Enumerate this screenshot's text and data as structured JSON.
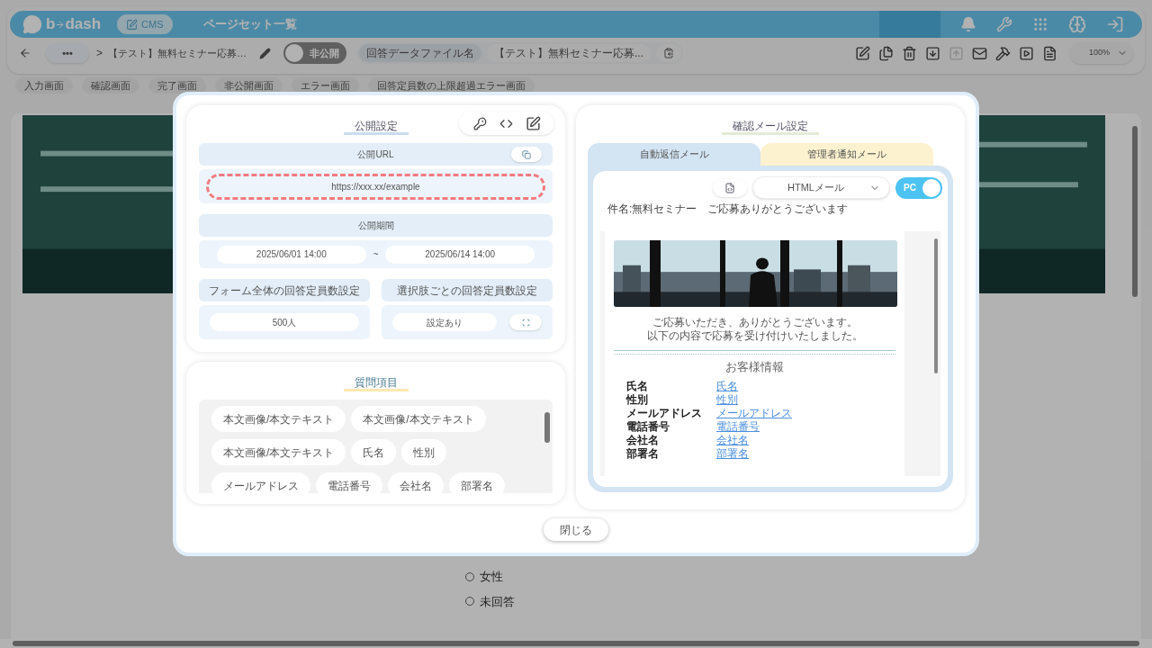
{
  "header": {
    "logo": [
      "b",
      "dash"
    ],
    "cms_badge": "CMS",
    "title": "ページセット一覧"
  },
  "toolbar": {
    "more": "•••",
    "separator": ">",
    "breadcrumb": "【テスト】無料セミナー応募…",
    "publish_toggle": {
      "label": "非公開",
      "on": false
    },
    "data_file": {
      "label": "回答データファイル名",
      "value": "【テスト】無料セミナー応募..."
    },
    "tools": [
      {
        "kind": "edit",
        "disabled": false
      },
      {
        "kind": "copy",
        "disabled": false
      },
      {
        "kind": "delete",
        "disabled": false
      },
      {
        "kind": "download",
        "disabled": false
      },
      {
        "kind": "upload",
        "disabled": true
      },
      {
        "kind": "mail",
        "disabled": false
      },
      {
        "kind": "tools",
        "disabled": false
      },
      {
        "kind": "play",
        "disabled": false
      },
      {
        "kind": "document",
        "disabled": false
      }
    ],
    "zoom": "100%"
  },
  "page_tabs": [
    "入力画面",
    "確認画面",
    "完了画面",
    "非公開画面",
    "エラー画面",
    "回答定員数の上限超過エラー画面"
  ],
  "form_options": [
    {
      "label": "女性",
      "selected": false
    },
    {
      "label": "未回答",
      "selected": false
    }
  ],
  "modal": {
    "publish": {
      "title": "公開設定",
      "url_label": "公開URL",
      "url": "https://xxx.xx/example",
      "period_label": "公開期間",
      "start": "2025/06/01 14:00",
      "tilde": "~",
      "end": "2025/06/14 14:00",
      "form_limit_label": "フォーム全体の回答定員数設定",
      "form_limit": "500人",
      "choice_limit_label": "選択肢ごとの回答定員数設定",
      "choice_limit": "設定あり"
    },
    "questions": {
      "title": "質問項目",
      "items": [
        "本文画像/本文テキスト",
        "本文画像/本文テキスト",
        "本文画像/本文テキスト",
        "氏名",
        "性別",
        "メールアドレス",
        "電話番号",
        "会社名",
        "部署名"
      ]
    },
    "mail": {
      "title": "確認メール設定",
      "tabs": [
        {
          "label": "自動返信メール",
          "selected": true
        },
        {
          "label": "管理者通知メール",
          "selected": false
        }
      ],
      "format": "HTMLメール",
      "device_toggle": {
        "label": "PC",
        "on": true
      },
      "subject": "件名:無料セミナー　ご応募ありがとうございます",
      "body_lines": [
        "ご応募いただき、ありがとうございます。",
        "以下の内容で応募を受け付けいたしました。"
      ],
      "section_title": "お客様情報",
      "fields": [
        {
          "label": "氏名",
          "value": "氏名"
        },
        {
          "label": "性別",
          "value": "性別"
        },
        {
          "label": "メールアドレス",
          "value": "メールアドレス"
        },
        {
          "label": "電話番号",
          "value": "電話番号"
        },
        {
          "label": "会社名",
          "value": "会社名"
        },
        {
          "label": "部署名",
          "value": "部署名"
        }
      ]
    },
    "close": "閉じる"
  }
}
